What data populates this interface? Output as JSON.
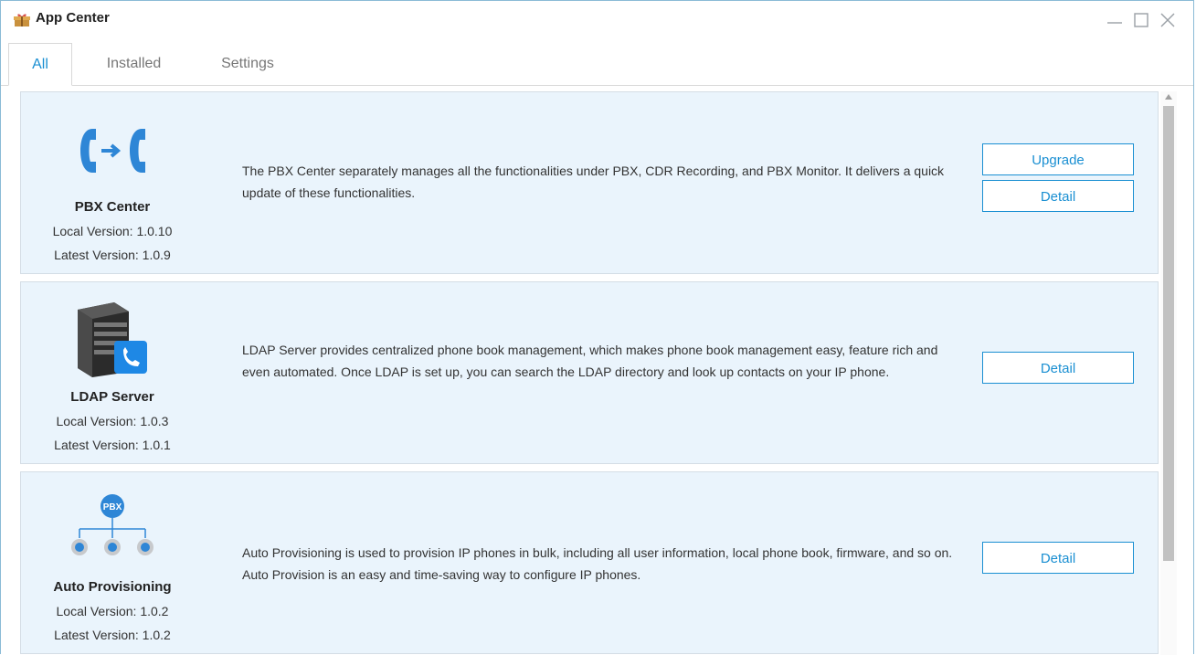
{
  "window": {
    "title": "App Center",
    "icon": "gift-box-icon",
    "controls": [
      "minimize-icon",
      "maximize-icon",
      "close-icon"
    ]
  },
  "tabs": [
    {
      "label": "All",
      "active": true
    },
    {
      "label": "Installed",
      "active": false
    },
    {
      "label": "Settings",
      "active": false
    }
  ],
  "apps": [
    {
      "name": "PBX Center",
      "icon": "call-transfer-icon",
      "local_version": "Local Version: 1.0.10",
      "latest_version": "Latest Version: 1.0.9",
      "description": "The PBX Center separately manages all the functionalities under PBX, CDR Recording, and PBX Monitor. It delivers a quick update of these functionalities.",
      "buttons": [
        "Upgrade",
        "Detail"
      ]
    },
    {
      "name": "LDAP Server",
      "icon": "server-phone-icon",
      "local_version": "Local Version: 1.0.3",
      "latest_version": "Latest Version: 1.0.1",
      "description": "LDAP Server provides centralized phone book management, which makes phone book management easy, feature rich and even automated. Once LDAP is set up, you can search the LDAP directory and look up contacts on your IP phone.",
      "buttons": [
        "Detail"
      ]
    },
    {
      "name": "Auto Provisioning",
      "icon": "pbx-tree-icon",
      "icon_text": "PBX",
      "local_version": "Local Version: 1.0.2",
      "latest_version": "Latest Version: 1.0.2",
      "description": "Auto Provisioning is used to provision IP phones in bulk, including all user information, local phone book, firmware, and so on. Auto Provision is an easy and time-saving way to configure IP phones.",
      "buttons": [
        "Detail"
      ]
    }
  ],
  "colors": {
    "accent": "#1a8fd2",
    "card_background": "#eaf4fc",
    "border": "#d4dde5"
  }
}
